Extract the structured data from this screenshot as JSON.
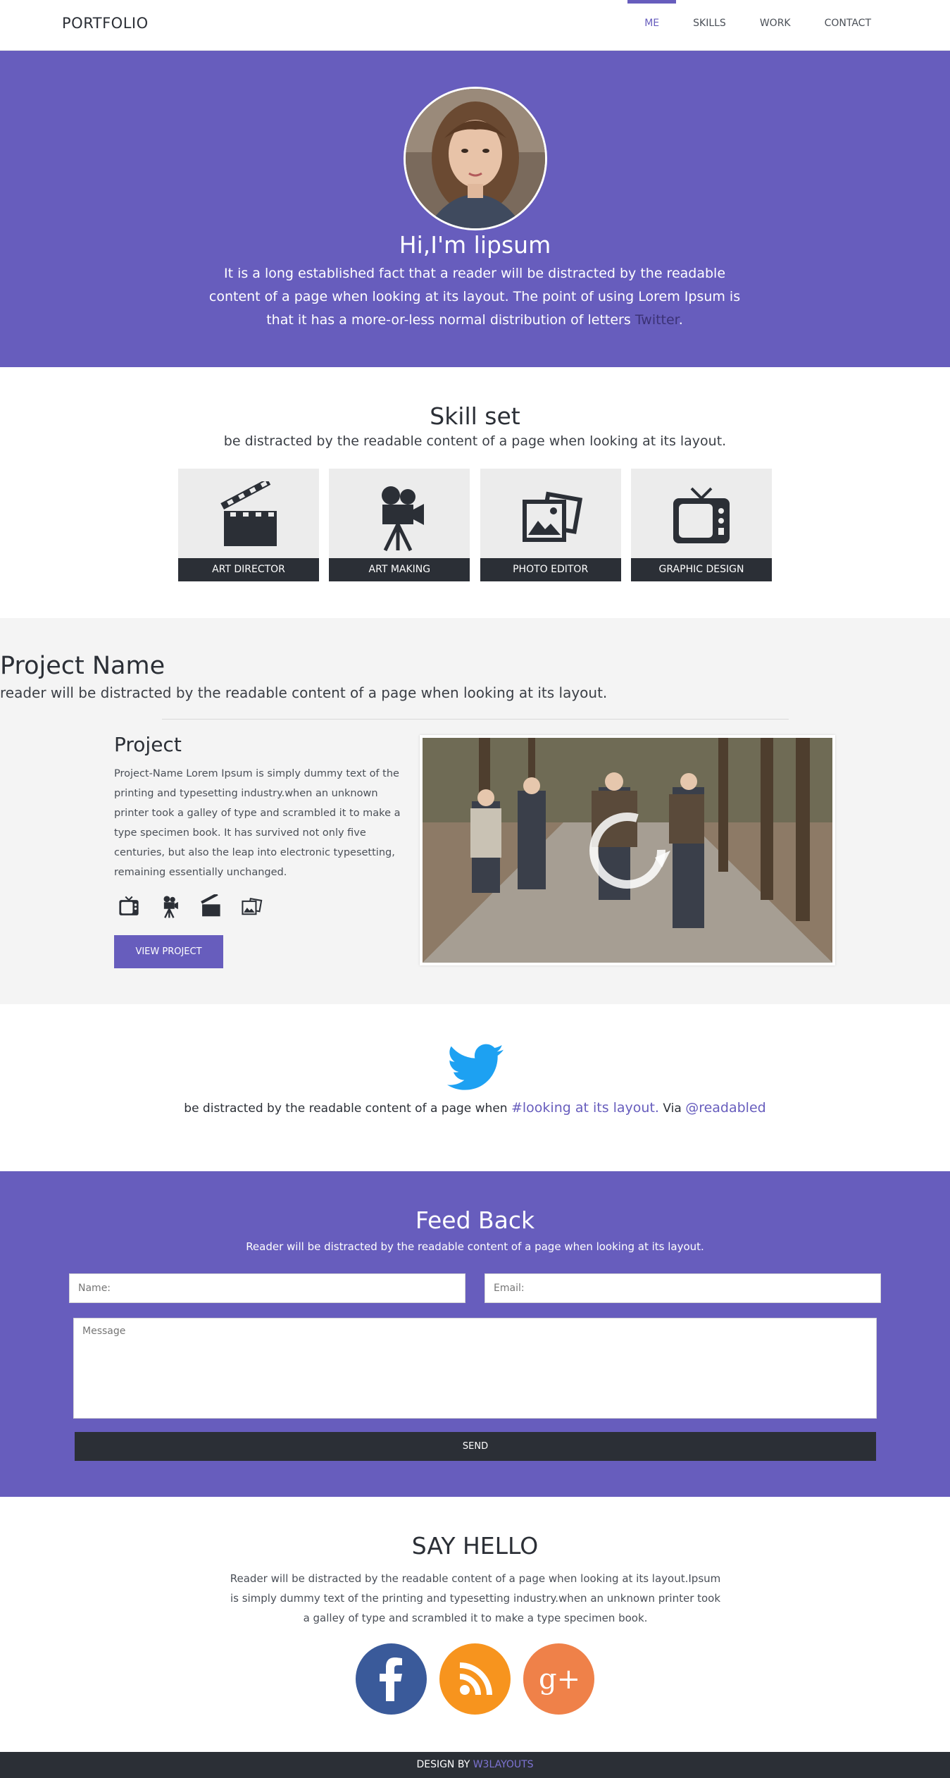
{
  "colors": {
    "accent": "#675dbd",
    "dark": "#2b2f36",
    "facebook": "#3a5a9a",
    "rss": "#f7941e",
    "googleplus": "#ef8149",
    "twitter": "#1da1f2"
  },
  "nav": {
    "brand": "PORTFOLIO",
    "items": [
      {
        "label": "ME",
        "active": true
      },
      {
        "label": "SKILLS"
      },
      {
        "label": "WORK"
      },
      {
        "label": "CONTACT"
      }
    ]
  },
  "hero": {
    "title": "Hi,I'm lipsum",
    "text": "It is a long established fact that a reader will be distracted by the readable content of a page when looking at its layout.  The point of using Lorem Ipsum is that it has a more-or-less normal distribution of letters ",
    "link": "Twitter",
    "after": "."
  },
  "skills": {
    "title": "Skill set",
    "subtitle": "be distracted by the readable content of a page when looking at its layout.",
    "items": [
      {
        "label": "ART DIRECTOR",
        "icon": "clapperboard-icon"
      },
      {
        "label": "ART MAKING",
        "icon": "movie-camera-icon"
      },
      {
        "label": "PHOTO EDITOR",
        "icon": "photos-icon"
      },
      {
        "label": "GRAPHIC DESIGN",
        "icon": "television-icon"
      }
    ]
  },
  "project": {
    "title": "Project Name",
    "subtitle": "reader will be distracted by the readable content of a page when looking at its layout.",
    "heading": "Project",
    "text": "Project-Name Lorem Ipsum is simply dummy text of the printing and typesetting industry.when an unknown printer took a galley of type and scrambled it to make a type specimen book. It has survived not only five centuries, but also the leap into electronic typesetting, remaining essentially unchanged.",
    "button": "VIEW PROJECT"
  },
  "twitter": {
    "text": "be distracted by the readable content of a page when ",
    "hashtag": "#looking at its layout.",
    "via": " Via ",
    "handle": "@readabled"
  },
  "feedback": {
    "title": "Feed Back",
    "subtitle": "Reader will be distracted by the readable content of a page when looking at its layout.",
    "name_placeholder": "Name:",
    "email_placeholder": "Email:",
    "message_placeholder": "Message",
    "send": "SEND"
  },
  "hello": {
    "title": "SAY HELLO",
    "text": "Reader will be distracted by the readable content of a page when looking at its layout.Ipsum is simply dummy text of the printing and typesetting industry.when an unknown printer took a galley of type and scrambled it to make a type specimen book."
  },
  "footer": {
    "prefix": "DESIGN BY ",
    "link": "W3LAYOUTS"
  }
}
